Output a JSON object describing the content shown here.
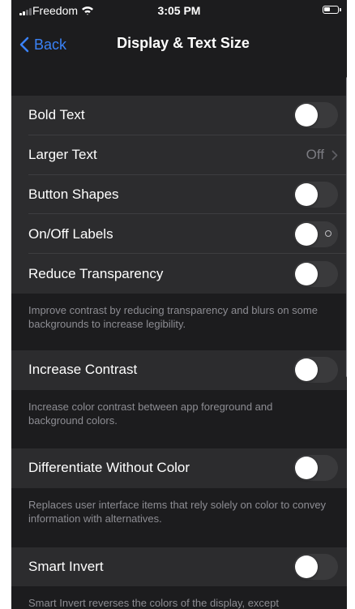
{
  "status_bar": {
    "carrier": "Freedom",
    "time": "3:05 PM",
    "battery_level": 0.45
  },
  "nav": {
    "back_label": "Back",
    "title": "Display & Text Size"
  },
  "rows": {
    "bold_text": "Bold Text",
    "larger_text": "Larger Text",
    "larger_text_value": "Off",
    "button_shapes": "Button Shapes",
    "on_off_labels": "On/Off Labels",
    "reduce_transparency": "Reduce Transparency",
    "increase_contrast": "Increase Contrast",
    "differentiate_without_color": "Differentiate Without Color",
    "smart_invert": "Smart Invert"
  },
  "toggles": {
    "bold_text": false,
    "button_shapes": false,
    "on_off_labels": false,
    "reduce_transparency": false,
    "increase_contrast": false,
    "differentiate_without_color": false,
    "smart_invert": false
  },
  "footers": {
    "reduce_transparency": "Improve contrast by reducing transparency and blurs on some backgrounds to increase legibility.",
    "increase_contrast": "Increase color contrast between app foreground and background colors.",
    "differentiate_without_color": "Replaces user interface items that rely solely on color to convey information with alternatives.",
    "smart_invert": "Smart Invert reverses the colors of the display, except"
  },
  "colors": {
    "accent": "#3a82f7",
    "background": "#1c1c1e",
    "cell_background": "#2c2c2e",
    "toggle_off_track": "#3a3a3c"
  },
  "icons": {
    "cellular": "cellular-signal-icon",
    "wifi": "wifi-icon",
    "battery": "battery-icon",
    "back": "chevron-left-icon",
    "disclosure": "chevron-right-icon"
  }
}
